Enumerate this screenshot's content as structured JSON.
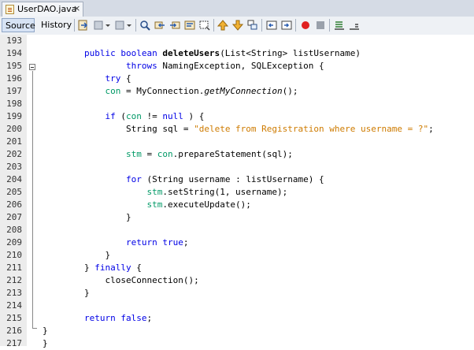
{
  "tab": {
    "title": "UserDAO.java",
    "close": "×"
  },
  "toolbar": {
    "source_label": "Source",
    "history_label": "History"
  },
  "lines": [
    {
      "n": "193",
      "segs": []
    },
    {
      "n": "194",
      "segs": [
        [
          "kw",
          "public "
        ],
        [
          "kw",
          "boolean "
        ],
        [
          "fn",
          "deleteUsers"
        ],
        [
          "",
          "(List<String> listUsername)"
        ]
      ]
    },
    {
      "n": "195",
      "segs": [
        [
          "",
          "        "
        ],
        [
          "kw",
          "throws "
        ],
        [
          "",
          "NamingException, SQLException {"
        ]
      ]
    },
    {
      "n": "196",
      "segs": [
        [
          "",
          "    "
        ],
        [
          "kw",
          "try "
        ],
        [
          "",
          "{"
        ]
      ]
    },
    {
      "n": "197",
      "segs": [
        [
          "",
          "        "
        ],
        [
          "fld",
          "con"
        ],
        [
          "",
          " = MyConnection."
        ],
        [
          "it",
          "getMyConnection"
        ],
        [
          "",
          "();"
        ]
      ]
    },
    {
      "n": "198",
      "segs": []
    },
    {
      "n": "199",
      "segs": [
        [
          "",
          "        "
        ],
        [
          "kw",
          "if "
        ],
        [
          "",
          "("
        ],
        [
          "fld",
          "con"
        ],
        [
          "",
          " != "
        ],
        [
          "kw",
          "null"
        ],
        [
          "",
          " ) {"
        ]
      ]
    },
    {
      "n": "200",
      "segs": [
        [
          "",
          "            String sql = "
        ],
        [
          "str",
          "\"delete from Registration where username = ?\""
        ],
        [
          "",
          ";"
        ]
      ]
    },
    {
      "n": "201",
      "segs": []
    },
    {
      "n": "202",
      "segs": [
        [
          "",
          "            "
        ],
        [
          "fld",
          "stm"
        ],
        [
          "",
          " = "
        ],
        [
          "fld",
          "con"
        ],
        [
          "",
          ".prepareStatement(sql);"
        ]
      ]
    },
    {
      "n": "203",
      "segs": []
    },
    {
      "n": "204",
      "segs": [
        [
          "",
          "            "
        ],
        [
          "kw",
          "for "
        ],
        [
          "",
          "(String username : listUsername) {"
        ]
      ]
    },
    {
      "n": "205",
      "segs": [
        [
          "",
          "                "
        ],
        [
          "fld",
          "stm"
        ],
        [
          "",
          ".setString(1, username);"
        ]
      ]
    },
    {
      "n": "206",
      "segs": [
        [
          "",
          "                "
        ],
        [
          "fld",
          "stm"
        ],
        [
          "",
          ".executeUpdate();"
        ]
      ]
    },
    {
      "n": "207",
      "segs": [
        [
          "",
          "            }"
        ]
      ]
    },
    {
      "n": "208",
      "segs": []
    },
    {
      "n": "209",
      "segs": [
        [
          "",
          "            "
        ],
        [
          "kw",
          "return "
        ],
        [
          "kw",
          "true"
        ],
        [
          "",
          ";"
        ]
      ]
    },
    {
      "n": "210",
      "segs": [
        [
          "",
          "        }"
        ]
      ]
    },
    {
      "n": "211",
      "segs": [
        [
          "",
          "    } "
        ],
        [
          "kw",
          "finally "
        ],
        [
          "",
          "{"
        ]
      ]
    },
    {
      "n": "212",
      "segs": [
        [
          "",
          "        closeConnection();"
        ]
      ]
    },
    {
      "n": "213",
      "segs": [
        [
          "",
          "    }"
        ]
      ]
    },
    {
      "n": "214",
      "segs": []
    },
    {
      "n": "215",
      "segs": [
        [
          "",
          "    "
        ],
        [
          "kw",
          "return "
        ],
        [
          "kw",
          "false"
        ],
        [
          "",
          ";"
        ]
      ]
    },
    {
      "n": "216",
      "segs": [
        [
          "",
          "}"
        ]
      ]
    },
    {
      "n": "217",
      "segs": [
        [
          "",
          "}"
        ]
      ]
    }
  ],
  "colors": {
    "keyword": "#0000e6",
    "field": "#009966",
    "string": "#ce7b00",
    "gutter": "#ececec"
  }
}
